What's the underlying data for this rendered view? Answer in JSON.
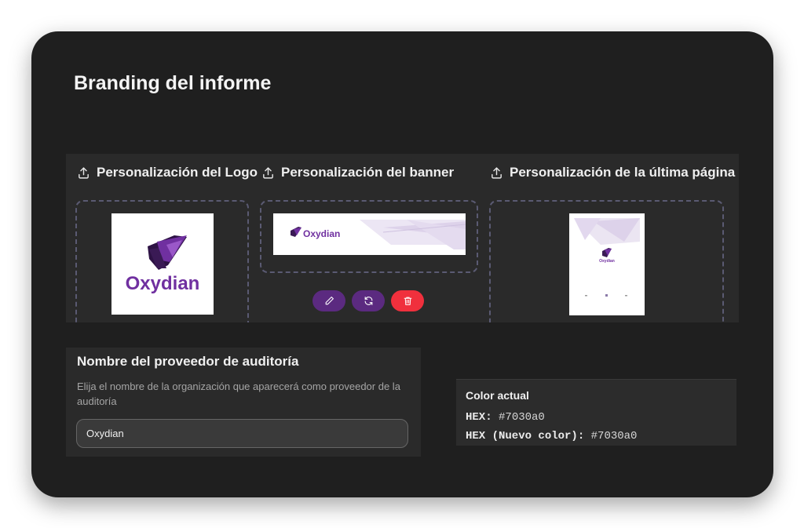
{
  "page": {
    "title": "Branding del informe"
  },
  "sections": {
    "logo": {
      "label": "Personalización del Logo",
      "icon": "upload-icon"
    },
    "banner": {
      "label": "Personalización del banner",
      "icon": "upload-icon"
    },
    "last_page": {
      "label": "Personalización de la última página",
      "icon": "upload-icon"
    }
  },
  "brand": {
    "name": "Oxydian",
    "color": "#7030a0"
  },
  "banner_actions": [
    {
      "name": "edit",
      "icon": "pencil-icon"
    },
    {
      "name": "replace",
      "icon": "refresh-icon"
    },
    {
      "name": "delete",
      "icon": "trash-icon"
    }
  ],
  "provider": {
    "title": "Nombre del proveedor de auditoría",
    "description": "Elija el nombre de la organización que aparecerá como proveedor de la auditoría",
    "value": "Oxydian"
  },
  "color_info": {
    "title": "Color actual",
    "hex_label": "HEX:",
    "hex_value": "#7030a0",
    "new_hex_label": "HEX (Nuevo color):",
    "new_hex_value": "#7030a0"
  }
}
